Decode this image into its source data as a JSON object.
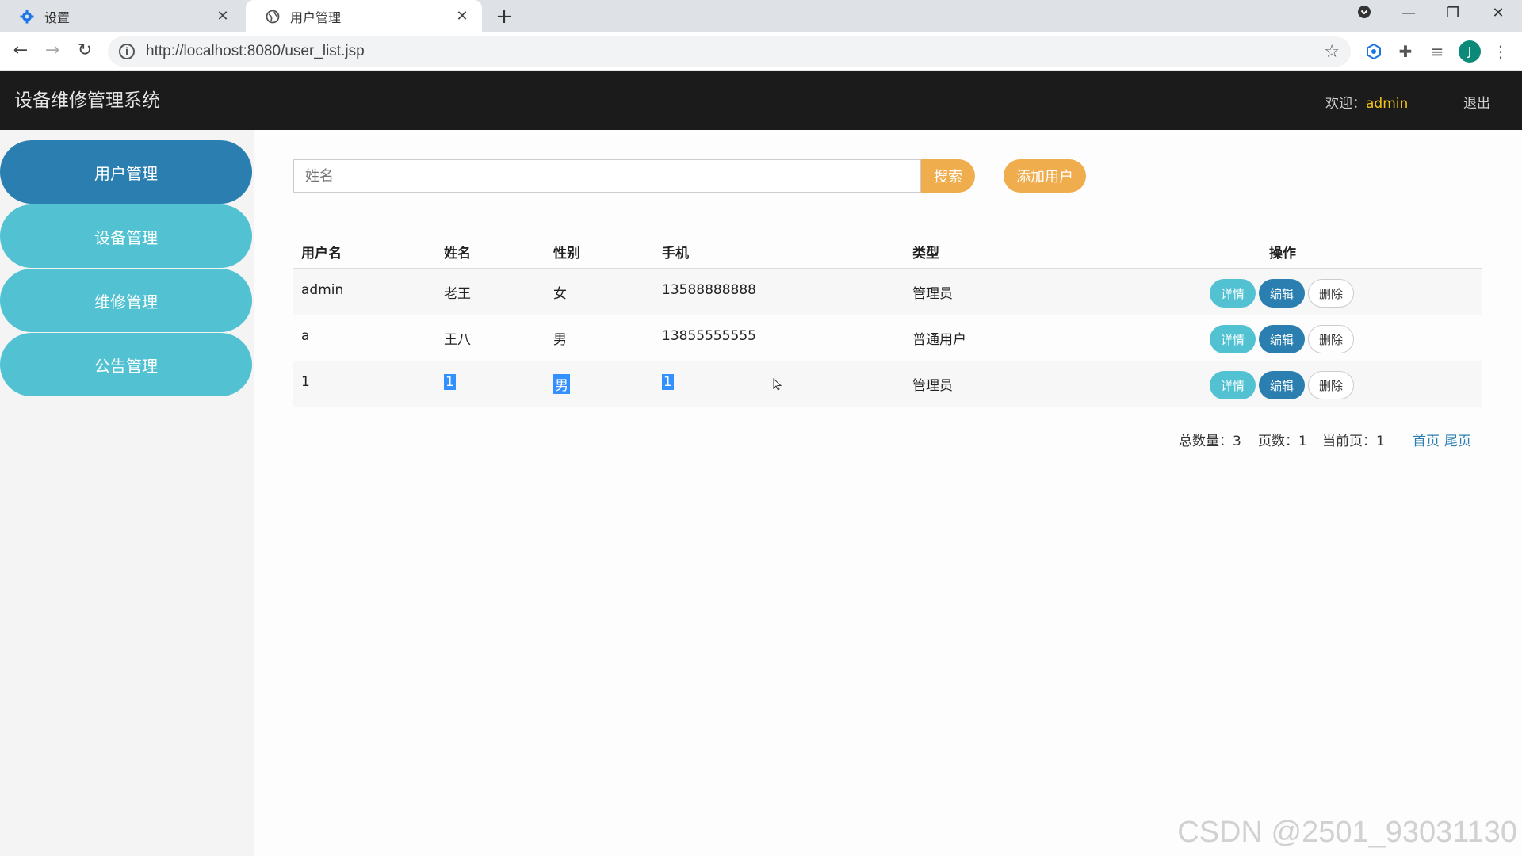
{
  "browser": {
    "tabs": [
      {
        "label": "设置",
        "icon": "gear-icon"
      },
      {
        "label": "用户管理",
        "icon": "globe-icon"
      }
    ],
    "url": "http://localhost:8080/user_list.jsp",
    "profile_initial": "J"
  },
  "header": {
    "title": "设备维修管理系统",
    "welcome_prefix": "欢迎：",
    "username": "admin",
    "logout": "退出"
  },
  "sidebar": {
    "items": [
      {
        "label": "用户管理",
        "active": true
      },
      {
        "label": "设备管理",
        "active": false
      },
      {
        "label": "维修管理",
        "active": false
      },
      {
        "label": "公告管理",
        "active": false
      }
    ]
  },
  "search": {
    "placeholder": "姓名",
    "button": "搜索",
    "add_button": "添加用户"
  },
  "table": {
    "headers": [
      "用户名",
      "姓名",
      "性别",
      "手机",
      "类型",
      "操作"
    ],
    "rows": [
      [
        "admin",
        "老王",
        "女",
        "13588888888",
        "管理员"
      ],
      [
        "a",
        "王八",
        "男",
        "13855555555",
        "普通用户"
      ],
      [
        "1",
        "1",
        "男",
        "1",
        "管理员"
      ]
    ],
    "actions": {
      "detail": "详情",
      "edit": "编辑",
      "delete": "删除"
    }
  },
  "pager": {
    "total": "总数量：3",
    "pages": "页数：1",
    "current": "当前页：1",
    "first": "首页",
    "last": "尾页"
  },
  "watermark": "CSDN @2501_93031130",
  "colors": {
    "header_bg": "#1b1b1b",
    "sidebar_active": "#2a7fb0",
    "sidebar_normal": "#52c2d2",
    "accent_orange": "#f0ad4e",
    "username": "#f5c518"
  }
}
